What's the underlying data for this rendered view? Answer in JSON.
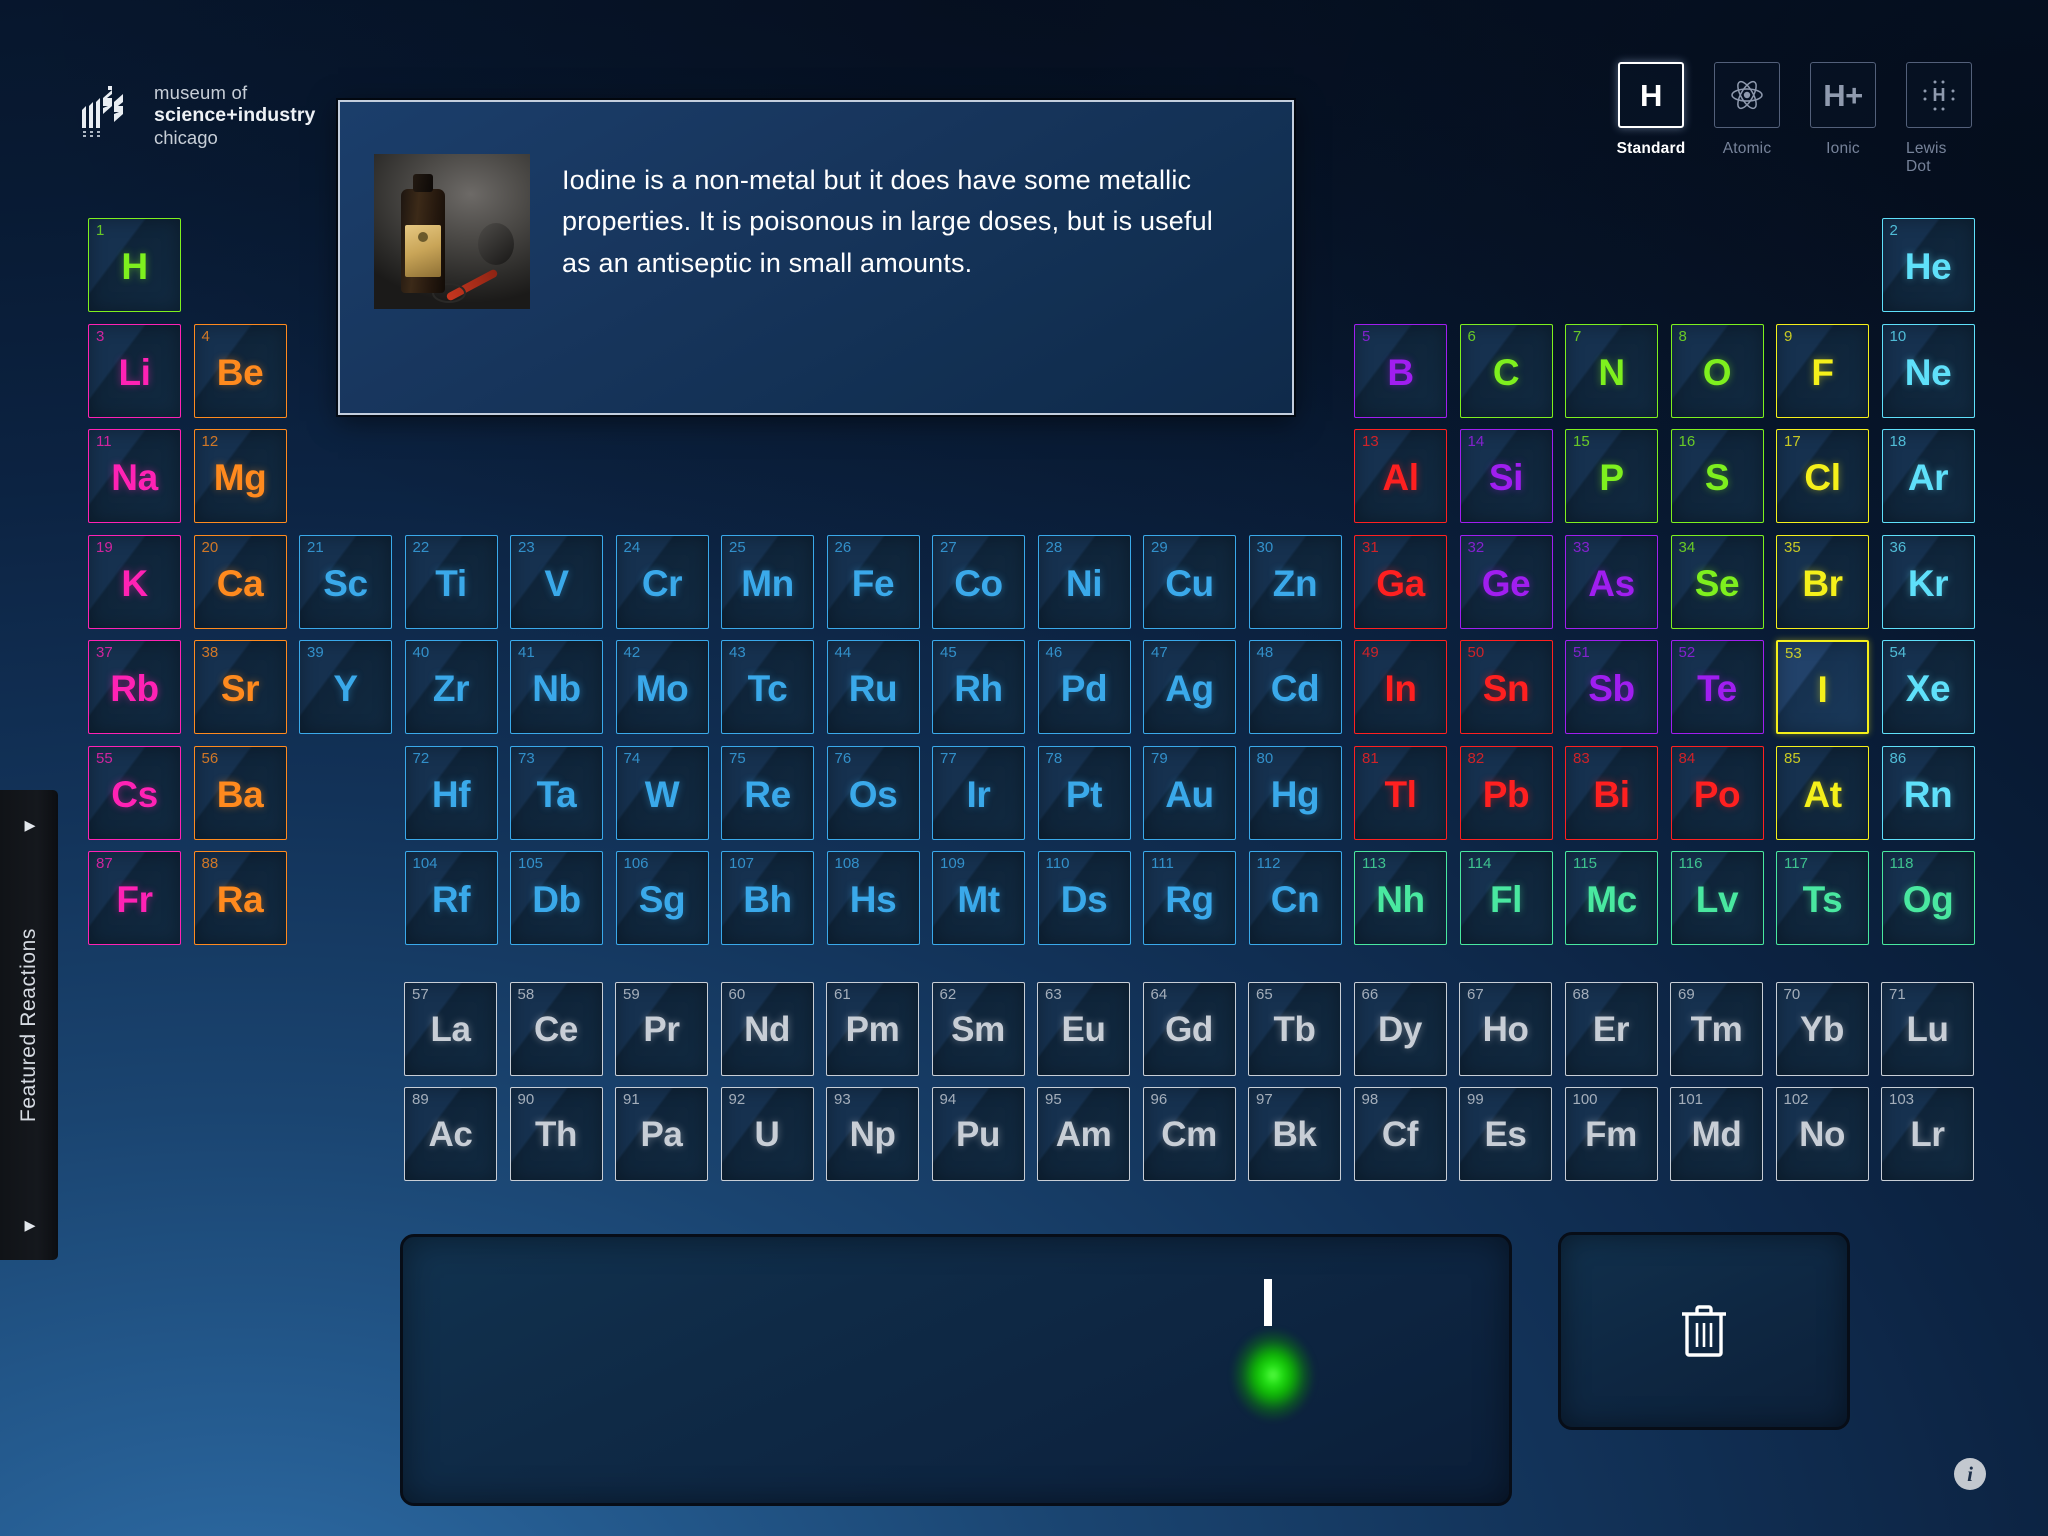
{
  "logo": {
    "line1": "museum of",
    "line2": "science+industry",
    "line3": "chicago",
    "icon": "msi-logo-icon"
  },
  "modes": [
    {
      "id": "standard",
      "label": "Standard",
      "glyph": "H",
      "icon": "standard-h-icon",
      "active": true
    },
    {
      "id": "atomic",
      "label": "Atomic",
      "glyph": "",
      "icon": "atom-icon",
      "active": false
    },
    {
      "id": "ionic",
      "label": "Ionic",
      "glyph": "H+",
      "icon": "ionic-hplus-icon",
      "active": false
    },
    {
      "id": "lewisdot",
      "label": "Lewis Dot",
      "glyph": "",
      "icon": "lewis-dot-icon",
      "active": false
    }
  ],
  "info_panel": {
    "text": "Iodine is a non-metal but it does have some metallic properties. It is poisonous in large doses, but is useful as an antiseptic in small amounts.",
    "image_alt": "iodine-tincture-bottle-photo"
  },
  "sidebar": {
    "label": "Featured Reactions",
    "arrow_top": "▸",
    "arrow_bottom": "▸"
  },
  "tray": {
    "symbol": "I",
    "glow_color": "#22e015",
    "trash_icon": "trash-icon"
  },
  "info_button": {
    "glyph": "i"
  },
  "selected_element": "I",
  "legend_colors": {
    "alkali": "#ff22b4",
    "alkaline_earth": "#ff8a1e",
    "transition": "#3aa9ea",
    "post_transition": "#ff2020",
    "metalloid": "#a01ef0",
    "nonmetal": "#7ef01e",
    "halogen": "#f5f01a",
    "noble": "#5fe0fa",
    "lanthanide": "#c8ced6",
    "unknown": "#49e8a0",
    "hydrogen": "#7ef01e"
  },
  "elements": [
    {
      "n": 1,
      "s": "H",
      "c": "#7ef01e",
      "r": 1,
      "g": 1
    },
    {
      "n": 2,
      "s": "He",
      "c": "#5fe0fa",
      "r": 1,
      "g": 18
    },
    {
      "n": 3,
      "s": "Li",
      "c": "#ff22b4",
      "r": 2,
      "g": 1
    },
    {
      "n": 4,
      "s": "Be",
      "c": "#ff8a1e",
      "r": 2,
      "g": 2
    },
    {
      "n": 5,
      "s": "B",
      "c": "#a01ef0",
      "r": 2,
      "g": 13
    },
    {
      "n": 6,
      "s": "C",
      "c": "#7ef01e",
      "r": 2,
      "g": 14
    },
    {
      "n": 7,
      "s": "N",
      "c": "#7ef01e",
      "r": 2,
      "g": 15
    },
    {
      "n": 8,
      "s": "O",
      "c": "#7ef01e",
      "r": 2,
      "g": 16
    },
    {
      "n": 9,
      "s": "F",
      "c": "#f5f01a",
      "r": 2,
      "g": 17
    },
    {
      "n": 10,
      "s": "Ne",
      "c": "#5fe0fa",
      "r": 2,
      "g": 18
    },
    {
      "n": 11,
      "s": "Na",
      "c": "#ff22b4",
      "r": 3,
      "g": 1
    },
    {
      "n": 12,
      "s": "Mg",
      "c": "#ff8a1e",
      "r": 3,
      "g": 2
    },
    {
      "n": 13,
      "s": "Al",
      "c": "#ff2020",
      "r": 3,
      "g": 13
    },
    {
      "n": 14,
      "s": "Si",
      "c": "#a01ef0",
      "r": 3,
      "g": 14
    },
    {
      "n": 15,
      "s": "P",
      "c": "#7ef01e",
      "r": 3,
      "g": 15
    },
    {
      "n": 16,
      "s": "S",
      "c": "#7ef01e",
      "r": 3,
      "g": 16
    },
    {
      "n": 17,
      "s": "Cl",
      "c": "#f5f01a",
      "r": 3,
      "g": 17
    },
    {
      "n": 18,
      "s": "Ar",
      "c": "#5fe0fa",
      "r": 3,
      "g": 18
    },
    {
      "n": 19,
      "s": "K",
      "c": "#ff22b4",
      "r": 4,
      "g": 1
    },
    {
      "n": 20,
      "s": "Ca",
      "c": "#ff8a1e",
      "r": 4,
      "g": 2
    },
    {
      "n": 21,
      "s": "Sc",
      "c": "#3aa9ea",
      "r": 4,
      "g": 3
    },
    {
      "n": 22,
      "s": "Ti",
      "c": "#3aa9ea",
      "r": 4,
      "g": 4
    },
    {
      "n": 23,
      "s": "V",
      "c": "#3aa9ea",
      "r": 4,
      "g": 5
    },
    {
      "n": 24,
      "s": "Cr",
      "c": "#3aa9ea",
      "r": 4,
      "g": 6
    },
    {
      "n": 25,
      "s": "Mn",
      "c": "#3aa9ea",
      "r": 4,
      "g": 7
    },
    {
      "n": 26,
      "s": "Fe",
      "c": "#3aa9ea",
      "r": 4,
      "g": 8
    },
    {
      "n": 27,
      "s": "Co",
      "c": "#3aa9ea",
      "r": 4,
      "g": 9
    },
    {
      "n": 28,
      "s": "Ni",
      "c": "#3aa9ea",
      "r": 4,
      "g": 10
    },
    {
      "n": 29,
      "s": "Cu",
      "c": "#3aa9ea",
      "r": 4,
      "g": 11
    },
    {
      "n": 30,
      "s": "Zn",
      "c": "#3aa9ea",
      "r": 4,
      "g": 12
    },
    {
      "n": 31,
      "s": "Ga",
      "c": "#ff2020",
      "r": 4,
      "g": 13
    },
    {
      "n": 32,
      "s": "Ge",
      "c": "#a01ef0",
      "r": 4,
      "g": 14
    },
    {
      "n": 33,
      "s": "As",
      "c": "#a01ef0",
      "r": 4,
      "g": 15
    },
    {
      "n": 34,
      "s": "Se",
      "c": "#7ef01e",
      "r": 4,
      "g": 16
    },
    {
      "n": 35,
      "s": "Br",
      "c": "#f5f01a",
      "r": 4,
      "g": 17
    },
    {
      "n": 36,
      "s": "Kr",
      "c": "#5fe0fa",
      "r": 4,
      "g": 18
    },
    {
      "n": 37,
      "s": "Rb",
      "c": "#ff22b4",
      "r": 5,
      "g": 1
    },
    {
      "n": 38,
      "s": "Sr",
      "c": "#ff8a1e",
      "r": 5,
      "g": 2
    },
    {
      "n": 39,
      "s": "Y",
      "c": "#3aa9ea",
      "r": 5,
      "g": 3
    },
    {
      "n": 40,
      "s": "Zr",
      "c": "#3aa9ea",
      "r": 5,
      "g": 4
    },
    {
      "n": 41,
      "s": "Nb",
      "c": "#3aa9ea",
      "r": 5,
      "g": 5
    },
    {
      "n": 42,
      "s": "Mo",
      "c": "#3aa9ea",
      "r": 5,
      "g": 6
    },
    {
      "n": 43,
      "s": "Tc",
      "c": "#3aa9ea",
      "r": 5,
      "g": 7
    },
    {
      "n": 44,
      "s": "Ru",
      "c": "#3aa9ea",
      "r": 5,
      "g": 8
    },
    {
      "n": 45,
      "s": "Rh",
      "c": "#3aa9ea",
      "r": 5,
      "g": 9
    },
    {
      "n": 46,
      "s": "Pd",
      "c": "#3aa9ea",
      "r": 5,
      "g": 10
    },
    {
      "n": 47,
      "s": "Ag",
      "c": "#3aa9ea",
      "r": 5,
      "g": 11
    },
    {
      "n": 48,
      "s": "Cd",
      "c": "#3aa9ea",
      "r": 5,
      "g": 12
    },
    {
      "n": 49,
      "s": "In",
      "c": "#ff2020",
      "r": 5,
      "g": 13
    },
    {
      "n": 50,
      "s": "Sn",
      "c": "#ff2020",
      "r": 5,
      "g": 14
    },
    {
      "n": 51,
      "s": "Sb",
      "c": "#a01ef0",
      "r": 5,
      "g": 15
    },
    {
      "n": 52,
      "s": "Te",
      "c": "#a01ef0",
      "r": 5,
      "g": 16
    },
    {
      "n": 53,
      "s": "I",
      "c": "#f5f01a",
      "r": 5,
      "g": 17,
      "sel": true
    },
    {
      "n": 54,
      "s": "Xe",
      "c": "#5fe0fa",
      "r": 5,
      "g": 18
    },
    {
      "n": 55,
      "s": "Cs",
      "c": "#ff22b4",
      "r": 6,
      "g": 1
    },
    {
      "n": 56,
      "s": "Ba",
      "c": "#ff8a1e",
      "r": 6,
      "g": 2
    },
    {
      "n": 72,
      "s": "Hf",
      "c": "#3aa9ea",
      "r": 6,
      "g": 4
    },
    {
      "n": 73,
      "s": "Ta",
      "c": "#3aa9ea",
      "r": 6,
      "g": 5
    },
    {
      "n": 74,
      "s": "W",
      "c": "#3aa9ea",
      "r": 6,
      "g": 6
    },
    {
      "n": 75,
      "s": "Re",
      "c": "#3aa9ea",
      "r": 6,
      "g": 7
    },
    {
      "n": 76,
      "s": "Os",
      "c": "#3aa9ea",
      "r": 6,
      "g": 8
    },
    {
      "n": 77,
      "s": "Ir",
      "c": "#3aa9ea",
      "r": 6,
      "g": 9
    },
    {
      "n": 78,
      "s": "Pt",
      "c": "#3aa9ea",
      "r": 6,
      "g": 10
    },
    {
      "n": 79,
      "s": "Au",
      "c": "#3aa9ea",
      "r": 6,
      "g": 11
    },
    {
      "n": 80,
      "s": "Hg",
      "c": "#3aa9ea",
      "r": 6,
      "g": 12
    },
    {
      "n": 81,
      "s": "Tl",
      "c": "#ff2020",
      "r": 6,
      "g": 13
    },
    {
      "n": 82,
      "s": "Pb",
      "c": "#ff2020",
      "r": 6,
      "g": 14
    },
    {
      "n": 83,
      "s": "Bi",
      "c": "#ff2020",
      "r": 6,
      "g": 15
    },
    {
      "n": 84,
      "s": "Po",
      "c": "#ff2020",
      "r": 6,
      "g": 16
    },
    {
      "n": 85,
      "s": "At",
      "c": "#f5f01a",
      "r": 6,
      "g": 17
    },
    {
      "n": 86,
      "s": "Rn",
      "c": "#5fe0fa",
      "r": 6,
      "g": 18
    },
    {
      "n": 87,
      "s": "Fr",
      "c": "#ff22b4",
      "r": 7,
      "g": 1
    },
    {
      "n": 88,
      "s": "Ra",
      "c": "#ff8a1e",
      "r": 7,
      "g": 2
    },
    {
      "n": 104,
      "s": "Rf",
      "c": "#3aa9ea",
      "r": 7,
      "g": 4
    },
    {
      "n": 105,
      "s": "Db",
      "c": "#3aa9ea",
      "r": 7,
      "g": 5
    },
    {
      "n": 106,
      "s": "Sg",
      "c": "#3aa9ea",
      "r": 7,
      "g": 6
    },
    {
      "n": 107,
      "s": "Bh",
      "c": "#3aa9ea",
      "r": 7,
      "g": 7
    },
    {
      "n": 108,
      "s": "Hs",
      "c": "#3aa9ea",
      "r": 7,
      "g": 8
    },
    {
      "n": 109,
      "s": "Mt",
      "c": "#3aa9ea",
      "r": 7,
      "g": 9
    },
    {
      "n": 110,
      "s": "Ds",
      "c": "#3aa9ea",
      "r": 7,
      "g": 10
    },
    {
      "n": 111,
      "s": "Rg",
      "c": "#3aa9ea",
      "r": 7,
      "g": 11
    },
    {
      "n": 112,
      "s": "Cn",
      "c": "#3aa9ea",
      "r": 7,
      "g": 12
    },
    {
      "n": 113,
      "s": "Nh",
      "c": "#49e8a0",
      "r": 7,
      "g": 13
    },
    {
      "n": 114,
      "s": "Fl",
      "c": "#49e8a0",
      "r": 7,
      "g": 14
    },
    {
      "n": 115,
      "s": "Mc",
      "c": "#49e8a0",
      "r": 7,
      "g": 15
    },
    {
      "n": 116,
      "s": "Lv",
      "c": "#49e8a0",
      "r": 7,
      "g": 16
    },
    {
      "n": 117,
      "s": "Ts",
      "c": "#49e8a0",
      "r": 7,
      "g": 17
    },
    {
      "n": 118,
      "s": "Og",
      "c": "#49e8a0",
      "r": 7,
      "g": 18
    }
  ],
  "lanthanides": [
    {
      "n": 57,
      "s": "La"
    },
    {
      "n": 58,
      "s": "Ce"
    },
    {
      "n": 59,
      "s": "Pr"
    },
    {
      "n": 60,
      "s": "Nd"
    },
    {
      "n": 61,
      "s": "Pm"
    },
    {
      "n": 62,
      "s": "Sm"
    },
    {
      "n": 63,
      "s": "Eu"
    },
    {
      "n": 64,
      "s": "Gd"
    },
    {
      "n": 65,
      "s": "Tb"
    },
    {
      "n": 66,
      "s": "Dy"
    },
    {
      "n": 67,
      "s": "Ho"
    },
    {
      "n": 68,
      "s": "Er"
    },
    {
      "n": 69,
      "s": "Tm"
    },
    {
      "n": 70,
      "s": "Yb"
    },
    {
      "n": 71,
      "s": "Lu"
    }
  ],
  "actinides": [
    {
      "n": 89,
      "s": "Ac"
    },
    {
      "n": 90,
      "s": "Th"
    },
    {
      "n": 91,
      "s": "Pa"
    },
    {
      "n": 92,
      "s": "U"
    },
    {
      "n": 93,
      "s": "Np"
    },
    {
      "n": 94,
      "s": "Pu"
    },
    {
      "n": 95,
      "s": "Am"
    },
    {
      "n": 96,
      "s": "Cm"
    },
    {
      "n": 97,
      "s": "Bk"
    },
    {
      "n": 98,
      "s": "Cf"
    },
    {
      "n": 99,
      "s": "Es"
    },
    {
      "n": 100,
      "s": "Fm"
    },
    {
      "n": 101,
      "s": "Md"
    },
    {
      "n": 102,
      "s": "No"
    },
    {
      "n": 103,
      "s": "Lr"
    }
  ]
}
